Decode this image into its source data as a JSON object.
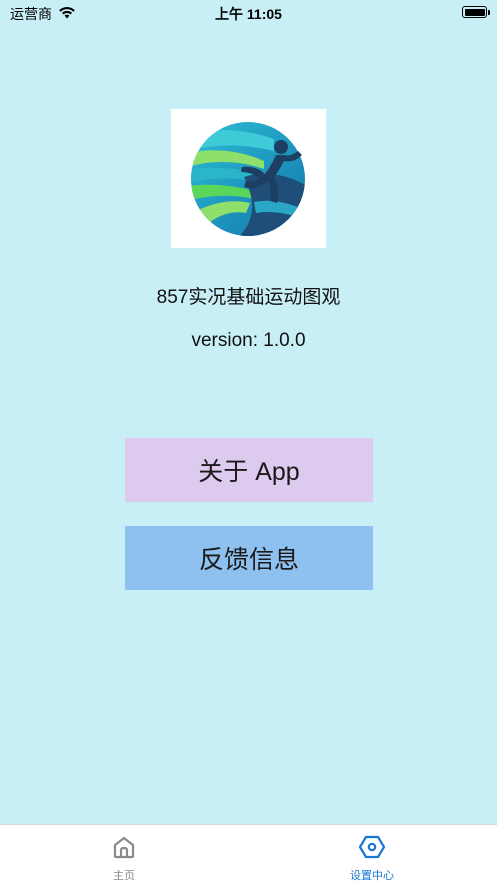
{
  "status_bar": {
    "carrier": "运营商",
    "time": "上午 11:05"
  },
  "app": {
    "name": "857实况基础运动图观",
    "version": "version: 1.0.0"
  },
  "buttons": {
    "about": "关于 App",
    "feedback": "反馈信息"
  },
  "tab_bar": {
    "items": [
      {
        "label": "主页",
        "icon": "home-icon",
        "active": false
      },
      {
        "label": "设置中心",
        "icon": "hexagon-settings-icon",
        "active": true
      }
    ]
  },
  "colors": {
    "background": "#c8eef6",
    "about_button": "#dccbee",
    "feedback_button": "#8ec1ef",
    "active_tab": "#1677d6",
    "inactive_tab": "#8a8a8a"
  }
}
